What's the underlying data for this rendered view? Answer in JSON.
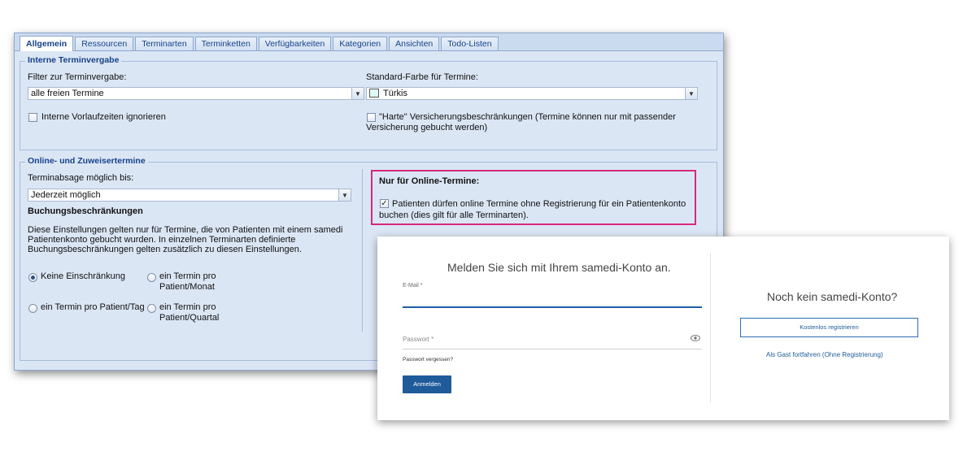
{
  "tabs": [
    "Allgemein",
    "Ressourcen",
    "Terminarten",
    "Terminketten",
    "Verfügbarkeiten",
    "Kategorien",
    "Ansichten",
    "Todo-Listen"
  ],
  "internal": {
    "legend": "Interne Terminvergabe",
    "filter_label": "Filter zur Terminvergabe:",
    "filter_value": "alle freien Termine",
    "color_label": "Standard-Farbe für Termine:",
    "color_value": "Türkis",
    "color_swatch": "#e0faf6",
    "ignore_lead_label": "Interne Vorlaufzeiten ignorieren",
    "ignore_lead_checked": false,
    "hard_insurance_label_line1": "\"Harte\" Versicherungsbeschränkungen (Termine können nur mit passender",
    "hard_insurance_label_line2": "Versicherung gebucht werden)",
    "hard_insurance_checked": false
  },
  "online": {
    "legend": "Online- und Zuweisertermine",
    "cancel_label": "Terminabsage möglich bis:",
    "cancel_value": "Jederzeit möglich",
    "restrictions_heading": "Buchungsbeschränkungen",
    "restrictions_text": [
      "Diese Einstellungen gelten nur für Termine, die von Patienten mit einem samedi",
      "Patientenkonto gebucht wurden. In einzelnen Terminarten definierte",
      "Buchungsbeschränkungen gelten zusätzlich zu diesen Einstellungen."
    ],
    "options": {
      "none": "Keine Einschränkung",
      "per_month_1": "ein Termin pro",
      "per_month_2": "Patient/Monat",
      "per_day": "ein Termin pro Patient/Tag",
      "per_quarter_1": "ein Termin pro",
      "per_quarter_2": "Patient/Quartal"
    },
    "selected_option": "none",
    "online_only_title": "Nur für Online-Termine:",
    "no_registration_line1": "Patienten dürfen online Termine ohne Registrierung für ein Patientenkonto",
    "no_registration_line2": "buchen (dies gilt für alle Terminarten).",
    "no_registration_checked": true
  },
  "login": {
    "title": "Melden Sie sich mit Ihrem samedi-Konto an.",
    "email_label": "E-Mail *",
    "password_label": "Passwort *",
    "forgot_link": "Passwort vergessen?",
    "login_button": "Anmelden",
    "no_account_title": "Noch kein samedi-Konto?",
    "register_button": "Kostenlos registrieren",
    "guest_link": "Als Gast fortfahren (Ohne Registrierung)",
    "accent_color": "#1f5b9a"
  },
  "highlight_color": "#d6297c"
}
